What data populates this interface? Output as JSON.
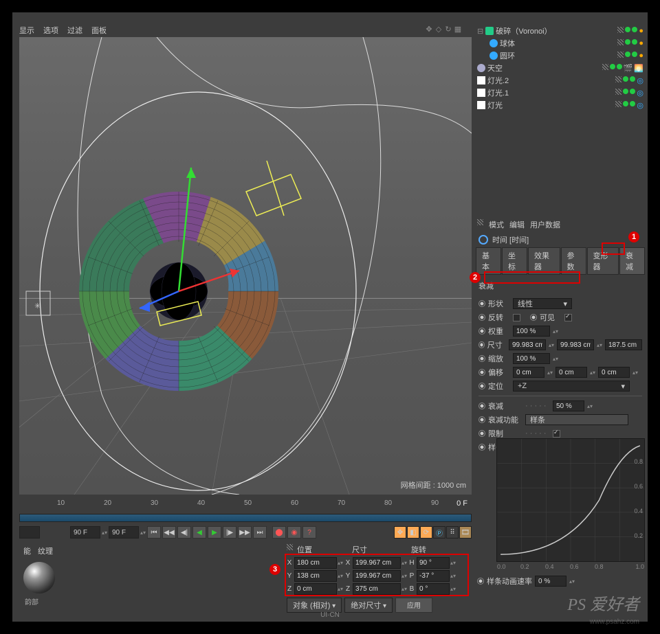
{
  "menu": {
    "m1": "显示",
    "m2": "选项",
    "m3": "过滤",
    "m4": "面板"
  },
  "viewport": {
    "grid_label": "网格间距 : 1000 cm"
  },
  "hierarchy": {
    "items": [
      {
        "name": "破碎（Voronoi）",
        "icon": "#2c8"
      },
      {
        "name": "球体",
        "icon": "#3af"
      },
      {
        "name": "圆环",
        "icon": "#3af"
      },
      {
        "name": "天空",
        "icon": "#aaa"
      },
      {
        "name": "灯光.2",
        "icon": "#fff"
      },
      {
        "name": "灯光.1",
        "icon": "#fff"
      },
      {
        "name": "灯光",
        "icon": "#fff"
      }
    ]
  },
  "ruler": {
    "ticks": [
      "10",
      "20",
      "30",
      "40",
      "50",
      "60",
      "70",
      "80",
      "90"
    ],
    "cur": "0 F"
  },
  "timeline": {
    "start": "",
    "end": "90 F",
    "cur": "90 F"
  },
  "material": {
    "tab1": "能",
    "tab2": "纹理",
    "name": "韵部"
  },
  "coord": {
    "hdr_icon": "",
    "h1": "位置",
    "h2": "尺寸",
    "h3": "旋转",
    "x": "180 cm",
    "sx": "199.967 cm",
    "rh": "90 °",
    "y": "138 cm",
    "sy": "199.967 cm",
    "rp": "-37 °",
    "z": "0 cm",
    "sz": "375 cm",
    "rb": "0 °",
    "mode1": "对象 (相对)",
    "mode2": "绝对尺寸",
    "apply": "应用"
  },
  "attr": {
    "tabs": {
      "t1": "模式",
      "t2": "编辑",
      "t3": "用户数据"
    },
    "title": "时间 [时间]",
    "tabrow": [
      "基本",
      "坐标",
      "效果器",
      "参数",
      "变形器",
      "衰减"
    ],
    "section": "衰减",
    "shape_lbl": "形状",
    "shape_val": "线性",
    "invert_lbl": "反转",
    "visible_lbl": "可见",
    "weight_lbl": "权重",
    "weight_val": "100 %",
    "size_lbl": "尺寸",
    "size_x": "99.983 cm",
    "size_y": "99.983 cm",
    "size_z": "187.5 cm",
    "scale_lbl": "缩放",
    "scale_val": "100 %",
    "offset_lbl": "偏移",
    "off_x": "0 cm",
    "off_y": "0 cm",
    "off_z": "0 cm",
    "orient_lbl": "定位",
    "orient_val": "+Z",
    "falloff_lbl": "衰减",
    "falloff_val": "50 %",
    "func_lbl": "衰减功能",
    "func_val": "样条",
    "clamp_lbl": "限制",
    "spline_lbl": "样条",
    "speed_lbl": "样条动画速率",
    "speed_val": "0 %",
    "gx0": "0.0",
    "gx1": "0.2",
    "gx2": "0.4",
    "gx3": "0.6",
    "gx4": "0.8",
    "gx5": "1.0",
    "gy0": "0.2",
    "gy1": "0.4",
    "gy2": "0.6",
    "gy3": "0.8"
  },
  "badges": {
    "b1": "1",
    "b2": "2",
    "b3": "3"
  },
  "watermark": "PS 爱好者",
  "watermark2": "www.psahz.com",
  "logo": "UI·CN"
}
